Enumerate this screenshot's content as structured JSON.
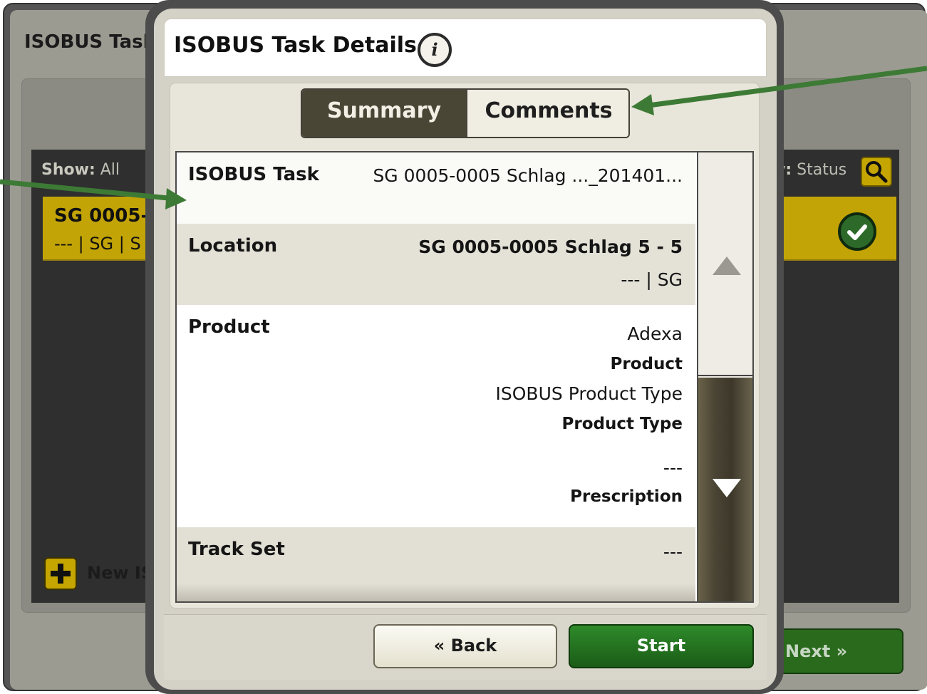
{
  "background": {
    "title": "ISOBUS Tasl",
    "show_label": "Show:",
    "show_value": "All",
    "sort_label": "y:",
    "sort_value": "Status",
    "row_title": "SG 0005-",
    "row_sub": "--- | SG | S",
    "new_button_label": "New ISC",
    "next_label": "Next »"
  },
  "dialog": {
    "title": "ISOBUS Task Details",
    "info_icon_glyph": "i",
    "tabs": [
      {
        "label": "Summary",
        "selected": true
      },
      {
        "label": "Comments",
        "selected": false
      }
    ],
    "rows": {
      "task": {
        "label": "ISOBUS Task",
        "value": "SG 0005-0005 Schlag ..._201401..."
      },
      "location": {
        "label": "Location",
        "value": "SG 0005-0005 Schlag 5 - 5",
        "sub": "--- | SG"
      },
      "product": {
        "label": "Product",
        "product_value": "Adexa",
        "product_caption": "Product",
        "type_value": "ISOBUS Product Type",
        "type_caption": "Product Type",
        "prescription_value": "---",
        "prescription_caption": "Prescription"
      },
      "track": {
        "label": "Track Set",
        "value": "---"
      }
    },
    "back_label": "« Back",
    "start_label": "Start"
  },
  "colors": {
    "accent_yellow": "#c3a406",
    "tab_selected": "#4a4636",
    "start_green": "#1f6a1b",
    "arrow_green": "#3d7a35"
  },
  "icons": [
    "info-icon",
    "search-icon",
    "checkmark-icon",
    "plus-icon",
    "scroll-up-icon",
    "scroll-down-icon"
  ]
}
